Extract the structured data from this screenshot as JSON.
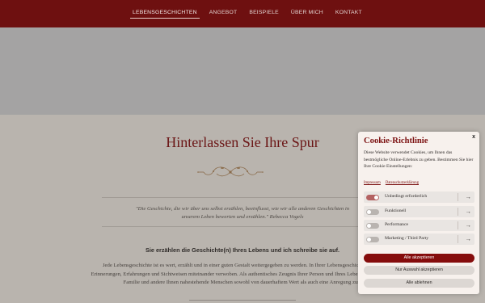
{
  "nav": {
    "items": [
      "LEBENSGESCHICHTEN",
      "ANGEBOT",
      "BEISPIELE",
      "ÜBER MICH",
      "KONTAKT"
    ]
  },
  "content": {
    "headline": "Hinterlassen Sie Ihre Spur",
    "quote_line1": "\"Die Geschichte, die wir über uns selbst erzählen, beeinflusst, wie wir alle anderen Geschichten in",
    "quote_line2": "unserem Leben bewerten und erzählen.\" Rebecca Vogels",
    "subhead": "Sie erzählen die Geschichte(n) Ihres Lebens und ich schreibe sie auf.",
    "body_line1": "Jede Lebensgeschichte ist es wert, erzählt und in einer guten Gestalt weitergegeben zu werden. In Ihrer Lebensgeschichte werden",
    "body_line2": "Erinnerungen, Erfahrungen und Sichtweisen miteinander verwoben. Als authentisches Zeugnis Ihrer Person und Ihres Lebens ist sie für Ihre",
    "body_line3": "Familie und andere Ihnen nahestehende Menschen sowohl von dauerhaftem Wert als auch eine Anregung zum"
  },
  "cookie": {
    "title": "Cookie-Richtlinie",
    "close": "x",
    "text": "Diese Website verwendet Cookies, um Ihnen das bestmögliche Online-Erlebnis zu geben. Bestimmen Sie hier Ihre Cookie Einstellungen:",
    "links": [
      "Impressum",
      "Datenschutzerklärung"
    ],
    "options": [
      {
        "label": "Unbedingt erforderlich",
        "enabled": true
      },
      {
        "label": "Funktionell",
        "enabled": false
      },
      {
        "label": "Performance",
        "enabled": false
      },
      {
        "label": "Marketing / Third Party",
        "enabled": false
      }
    ],
    "accept_all": "Alle akzeptieren",
    "accept_selection": "Nur Auswahl akzeptieren",
    "reject_all": "Alle ablehnen"
  },
  "colors": {
    "nav_bg": "#6e1010",
    "accent": "#850c0c",
    "headline": "#6b1616"
  },
  "icons": {
    "option_arrow": "arrow-right-icon",
    "ornament": "floral-ornament-icon"
  }
}
